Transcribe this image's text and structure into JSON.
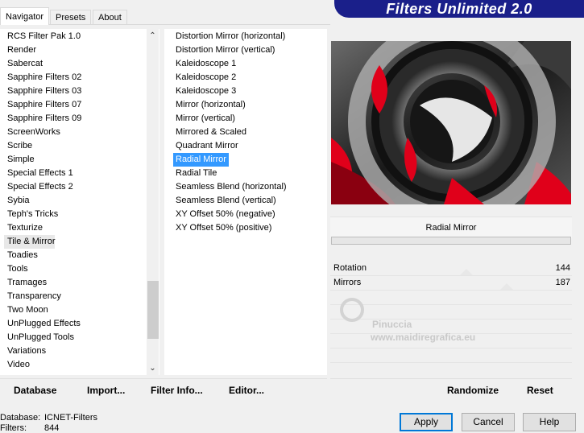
{
  "tabs": [
    "Navigator",
    "Presets",
    "About"
  ],
  "banner_title": "Filters Unlimited 2.0",
  "categories": [
    "RCS Filter Pak 1.0",
    "Render",
    "Sabercat",
    "Sapphire Filters 02",
    "Sapphire Filters 03",
    "Sapphire Filters 07",
    "Sapphire Filters 09",
    "ScreenWorks",
    "Scribe",
    "Simple",
    "Special Effects 1",
    "Special Effects 2",
    "Sybia",
    "Teph's Tricks",
    "Texturize",
    "Tile & Mirror",
    "Toadies",
    "Tools",
    "Tramages",
    "Transparency",
    "Two Moon",
    "UnPlugged Effects",
    "UnPlugged Tools",
    "Variations",
    "Video"
  ],
  "highlighted_category": "Tile & Mirror",
  "filters": [
    "Distortion Mirror (horizontal)",
    "Distortion Mirror (vertical)",
    "Kaleidoscope 1",
    "Kaleidoscope 2",
    "Kaleidoscope 3",
    "Mirror (horizontal)",
    "Mirror (vertical)",
    "Mirrored & Scaled",
    "Quadrant Mirror",
    "Radial Mirror",
    "Radial Tile",
    "Seamless Blend (horizontal)",
    "Seamless Blend (vertical)",
    "XY Offset 50% (negative)",
    "XY Offset 50% (positive)"
  ],
  "selected_filter": "Radial Mirror",
  "filter_name_display": "Radial Mirror",
  "params": [
    {
      "label": "Rotation",
      "value": "144"
    },
    {
      "label": "Mirrors",
      "value": "187"
    }
  ],
  "watermark": {
    "line1": "Pinuccia",
    "line2": "www.maidiregrafica.eu"
  },
  "toolbar": {
    "database": "Database",
    "import": "Import...",
    "filter_info": "Filter Info...",
    "editor": "Editor...",
    "randomize": "Randomize",
    "reset": "Reset"
  },
  "status": {
    "database_label": "Database:",
    "database_value": "ICNET-Filters",
    "filters_label": "Filters:",
    "filters_value": "844"
  },
  "buttons": {
    "apply": "Apply",
    "cancel": "Cancel",
    "help": "Help"
  },
  "colors": {
    "banner": "#1a1f8a",
    "selection": "#3399ff",
    "preview_red": "#e0001a"
  }
}
